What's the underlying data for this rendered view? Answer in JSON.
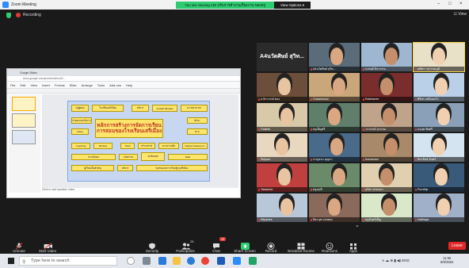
{
  "window": {
    "title": "Zoom Meeting",
    "share_banner": "You are viewing ADI ปรับการทำงานเรื่องงาน ของครู",
    "view_options": "View Options ▾",
    "min": "–",
    "max": "□",
    "close": "×"
  },
  "meeting": {
    "recording_label": "Recording",
    "view_label": "☷ View"
  },
  "shared_screen": {
    "browser_tab": "Google Slides",
    "address": "docs.google.com/presentation/d/...",
    "menu": [
      "File",
      "Edit",
      "View",
      "Insert",
      "Format",
      "Slide",
      "Arrange",
      "Tools",
      "Add-ons",
      "Help"
    ],
    "slide_title_1": "หลักการสร้างการจัดการเรียน",
    "slide_title_2": "การสอนของโรงเรียนเสรีเมือง",
    "slide_boxes": [
      "ครูผู้สอน",
      "โรงเรียนเสรีเมือง",
      "บริหาร",
      "Growth Mindset",
      "ความสามารถ",
      "การออกแบบกิจกรรม",
      "Active",
      "ทักษะ",
      "PLC",
      "Coaching",
      "Mindset",
      "Think",
      "สร้างสรรค์",
      "ความร่วมมือ",
      "Flipped Classroom",
      "ประเมินผล",
      "นวัตกรรม",
      "สะท้อนผล",
      "Data",
      "ชุมชนแห่งการเรียนรู้ครูเสรีเมือง",
      "ผู้เรียนเป็นสำคัญ"
    ],
    "notes_placeholder": "Click to add speaker notes"
  },
  "gallery": {
    "tiles": [
      {
        "name": "",
        "big": "A4นวัตศิษย์ สุวิท..."
      },
      {
        "name": "A4นวัตศิษย์ สุวิท..."
      },
      {
        "name": "นรพงศ์ นิลวรรณ"
      },
      {
        "name": "สุพัตรา สุวรรณภูมิ"
      },
      {
        "name": "อ.จิราภรณ์ ทอง"
      },
      {
        "name": "Chaweewan"
      },
      {
        "name": "Ratchanee"
      },
      {
        "name": "ศิริพร เหมือนแก้ว"
      },
      {
        "name": "Orathai"
      },
      {
        "name": "ครูเพ็ญศรี"
      },
      {
        "name": "วราภรณ์ สุวรรณ"
      },
      {
        "name": "นงนุช ชัยศรี"
      },
      {
        "name": "Siriporn"
      },
      {
        "name": "กาญจนา บุญมา"
      },
      {
        "name": "Kanokwan"
      },
      {
        "name": "ธิดารัตน์ จันทร์"
      },
      {
        "name": "Tassanee"
      },
      {
        "name": "ครูอรุณี"
      },
      {
        "name": "สุนิสา พรหมมา"
      },
      {
        "name": "Pornthip"
      },
      {
        "name": "Wipawee"
      },
      {
        "name": "ปิยะนุช แสงทอง"
      },
      {
        "name": "ครูจันทร์เพ็ญ"
      },
      {
        "name": "Natthaya"
      }
    ]
  },
  "toolbar": {
    "unmute": "Unmute",
    "start_video": "Start Video",
    "security": "Security",
    "participants": "Participants",
    "participants_count": "28",
    "chat": "Chat",
    "chat_badge": "19",
    "share_screen": "Share Screen",
    "record": "Record",
    "breakout": "Breakout Rooms",
    "reactions": "Reactions",
    "apps": "Apps",
    "leave": "Leave"
  },
  "taskbar": {
    "search_placeholder": "Type here to search",
    "tray": "∧ ☁ ⊕ ▮ ◀) ENG",
    "time": "11:55",
    "date": "8/9/2564"
  },
  "colors": {
    "accent_green": "#2ecc71",
    "leave_red": "#e02828",
    "slide_yellow": "#fde46a"
  }
}
